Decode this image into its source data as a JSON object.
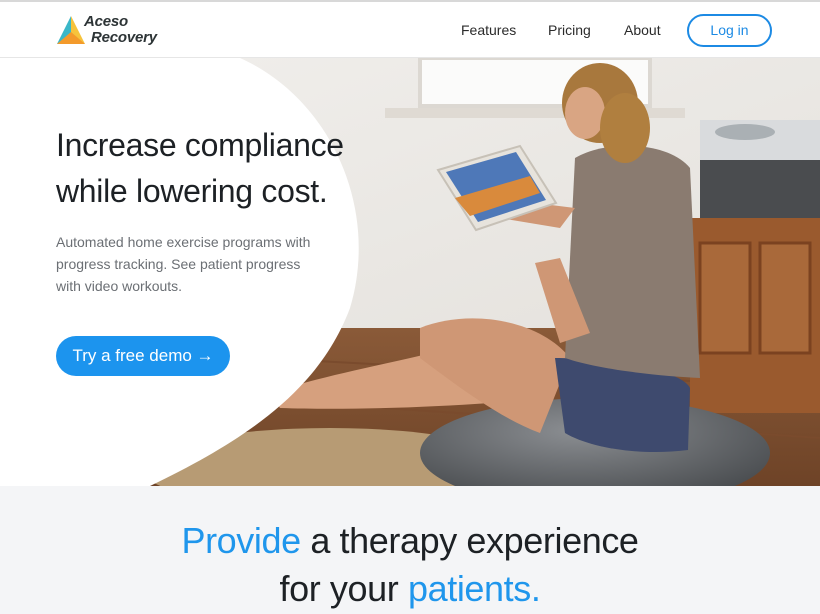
{
  "brand": {
    "name_line1": "Aceso",
    "name_line2": "Recovery",
    "colors": {
      "accent": "#1c94ee",
      "logo_orange": "#f39a2b",
      "logo_yellow": "#f6c33c",
      "logo_teal": "#3ab7c8"
    }
  },
  "nav": {
    "features": "Features",
    "pricing": "Pricing",
    "about": "About",
    "login": "Log in"
  },
  "hero": {
    "title_line1": "Increase compliance",
    "title_line2": "while lowering cost.",
    "subtitle": "Automated home exercise programs with progress tracking. See patient progress with video workouts.",
    "cta": "Try a free demo →",
    "image": "woman-on-balance-ball-with-tablet"
  },
  "feature": {
    "line1_highlight": "Provide",
    "line1_rest": " a therapy experience",
    "line2_start": "for your ",
    "line2_highlight": "patients."
  }
}
